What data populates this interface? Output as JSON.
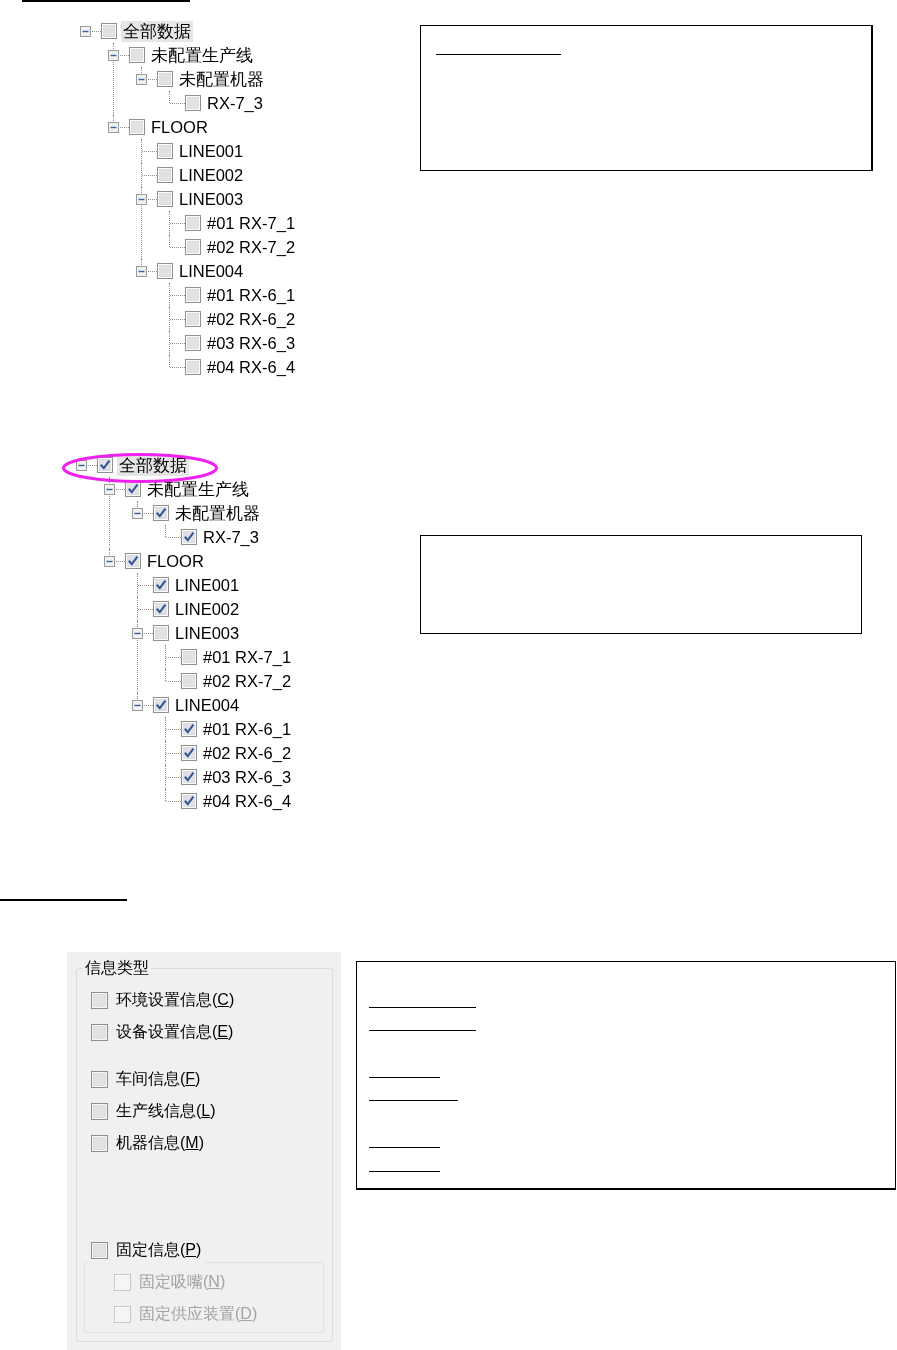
{
  "tree_before": {
    "nodes": [
      {
        "label": "全部数据",
        "checked": false,
        "selected": true,
        "expanded": true,
        "children": [
          {
            "label": "未配置生产线",
            "checked": false,
            "selected": false,
            "expanded": true,
            "children": [
              {
                "label": "未配置机器",
                "checked": false,
                "selected": false,
                "expanded": true,
                "children": [
                  {
                    "label": "RX-7_3",
                    "checked": false,
                    "selected": false
                  }
                ]
              }
            ]
          },
          {
            "label": "FLOOR",
            "checked": false,
            "selected": false,
            "expanded": true,
            "children": [
              {
                "label": "LINE001",
                "checked": false,
                "selected": false
              },
              {
                "label": "LINE002",
                "checked": false,
                "selected": false
              },
              {
                "label": "LINE003",
                "checked": false,
                "selected": false,
                "expanded": true,
                "children": [
                  {
                    "label": "#01 RX-7_1",
                    "checked": false,
                    "selected": false
                  },
                  {
                    "label": "#02 RX-7_2",
                    "checked": false,
                    "selected": false
                  }
                ]
              },
              {
                "label": "LINE004",
                "checked": false,
                "selected": false,
                "expanded": true,
                "children": [
                  {
                    "label": "#01 RX-6_1",
                    "checked": false,
                    "selected": false
                  },
                  {
                    "label": "#02 RX-6_2",
                    "checked": false,
                    "selected": false
                  },
                  {
                    "label": "#03 RX-6_3",
                    "checked": false,
                    "selected": false
                  },
                  {
                    "label": "#04 RX-6_4",
                    "checked": false,
                    "selected": false
                  }
                ]
              }
            ]
          }
        ]
      }
    ]
  },
  "tree_after": {
    "highlight_root": true,
    "nodes": [
      {
        "label": "全部数据",
        "checked": true,
        "selected": true,
        "expanded": true,
        "children": [
          {
            "label": "未配置生产线",
            "checked": true,
            "selected": false,
            "expanded": true,
            "children": [
              {
                "label": "未配置机器",
                "checked": true,
                "selected": false,
                "expanded": true,
                "children": [
                  {
                    "label": "RX-7_3",
                    "checked": true,
                    "selected": false
                  }
                ]
              }
            ]
          },
          {
            "label": "FLOOR",
            "checked": true,
            "selected": false,
            "expanded": true,
            "children": [
              {
                "label": "LINE001",
                "checked": true,
                "selected": false
              },
              {
                "label": "LINE002",
                "checked": true,
                "selected": false
              },
              {
                "label": "LINE003",
                "checked": false,
                "selected": false,
                "expanded": true,
                "children": [
                  {
                    "label": "#01 RX-7_1",
                    "checked": false,
                    "selected": false
                  },
                  {
                    "label": "#02 RX-7_2",
                    "checked": false,
                    "selected": false
                  }
                ]
              },
              {
                "label": "LINE004",
                "checked": true,
                "selected": false,
                "expanded": true,
                "children": [
                  {
                    "label": "#01 RX-6_1",
                    "checked": true,
                    "selected": false
                  },
                  {
                    "label": "#02 RX-6_2",
                    "checked": true,
                    "selected": false
                  },
                  {
                    "label": "#03 RX-6_3",
                    "checked": true,
                    "selected": false
                  },
                  {
                    "label": "#04 RX-6_4",
                    "checked": true,
                    "selected": false
                  }
                ]
              }
            ]
          }
        ]
      }
    ]
  },
  "info_type_group": {
    "title": "信息类型",
    "option_groups": [
      {
        "options": [
          {
            "label": "环境设置信息(C)",
            "checked": false,
            "disabled": false
          },
          {
            "label": "设备设置信息(E)",
            "checked": false,
            "disabled": false
          }
        ]
      },
      {
        "options": [
          {
            "label": "车间信息(F)",
            "checked": false,
            "disabled": false
          },
          {
            "label": "生产线信息(L)",
            "checked": false,
            "disabled": false
          },
          {
            "label": "机器信息(M)",
            "checked": false,
            "disabled": false
          }
        ]
      }
    ],
    "fixed_option": {
      "label": "固定信息(P)",
      "checked": false,
      "disabled": false,
      "sub_options": [
        {
          "label": "固定吸嘴(N)",
          "checked": false,
          "disabled": true
        },
        {
          "label": "固定供应装置(D)",
          "checked": false,
          "disabled": true
        }
      ]
    }
  }
}
